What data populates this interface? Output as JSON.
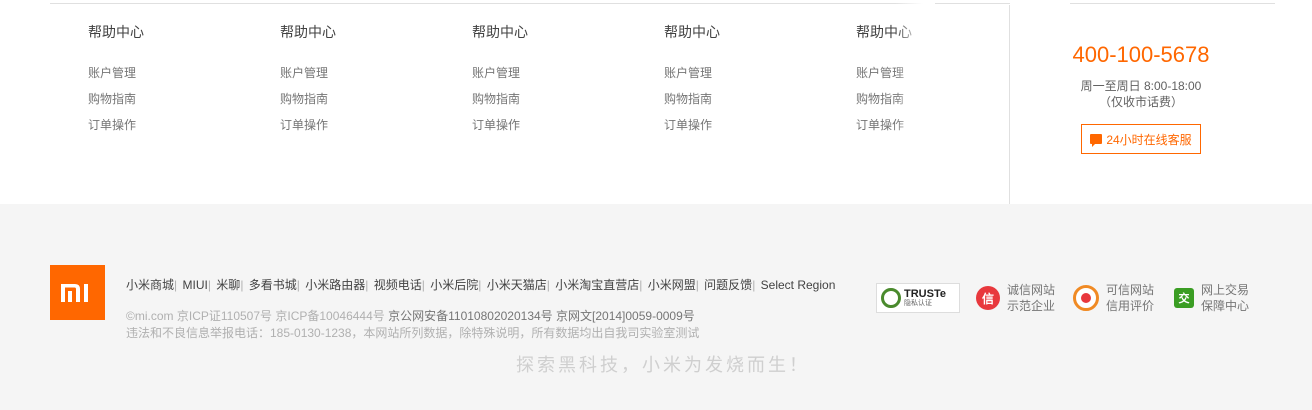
{
  "help_columns": [
    {
      "title": "帮助中心",
      "links": [
        "账户管理",
        "购物指南",
        "订单操作"
      ]
    },
    {
      "title": "帮助中心",
      "links": [
        "账户管理",
        "购物指南",
        "订单操作"
      ]
    },
    {
      "title": "帮助中心",
      "links": [
        "账户管理",
        "购物指南",
        "订单操作"
      ]
    },
    {
      "title": "帮助中心",
      "links": [
        "账户管理",
        "购物指南",
        "订单操作"
      ]
    },
    {
      "title": "帮助中心",
      "links": [
        "账户管理",
        "购物指南",
        "订单操作"
      ]
    }
  ],
  "contact": {
    "phone": "400-100-5678",
    "hours_line1": "周一至周日 8:00-18:00",
    "hours_line2": "（仅收市话费）",
    "service_button": "24小时在线客服",
    "service_icon": "chat-bubble-icon"
  },
  "footer": {
    "logo_text": "mi",
    "site_links": [
      "小米商城",
      "MIUI",
      "米聊",
      "多看书城",
      "小米路由器",
      "视频电话",
      "小米后院",
      "小米天猫店",
      "小米淘宝直营店",
      "小米网盟",
      "问题反馈",
      "Select Region"
    ],
    "copyright_prefix": "©mi.com",
    "icp_1": "京ICP证110507号",
    "icp_2": "京ICP备10046444号",
    "icp_3": "京公网安备11010802020134号",
    "icp_4": "京网文[2014]0059-0009号",
    "report_line": "违法和不良信息举报电话：185-0130-1238，本网站所列数据，除特殊说明，所有数据均出自我司实验室测试",
    "slogan": "探索黑科技，小米为发烧而生！"
  },
  "badges": {
    "truste_label": "TRUSTe",
    "truste_sub": "隐私认证",
    "integrity_line1": "诚信网站",
    "integrity_line2": "示范企业",
    "integrity_icon_char": "信",
    "credible_line1": "可信网站",
    "credible_line2": "信用评价",
    "trade_line1": "网上交易",
    "trade_line2": "保障中心",
    "trade_icon_char": "交"
  },
  "colors": {
    "accent": "#ff6700",
    "footer_bg": "#f5f5f5",
    "integrity_red": "#e8383d",
    "trade_green": "#3a9d23"
  }
}
